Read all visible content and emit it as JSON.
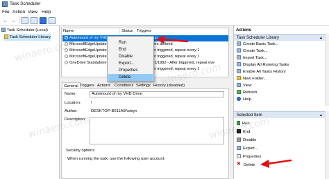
{
  "window": {
    "title": "Task Scheduler"
  },
  "menu": [
    "File",
    "Action",
    "View",
    "Help"
  ],
  "tree": {
    "items": [
      {
        "label": "Task Scheduler (Local)",
        "selected": false
      },
      {
        "label": "Task Scheduler Library",
        "selected": true
      }
    ]
  },
  "task_list": {
    "columns": [
      "Name",
      "Status",
      "Triggers"
    ],
    "rows": [
      {
        "name": "Automount of my VHD ...",
        "trigger": "startup",
        "selected": true
      },
      {
        "name": "MicrosoftEdgeUpdateT...",
        "trigger": "triggers defined",
        "selected": false
      },
      {
        "name": "MicrosoftEdgeUpdateT...",
        "trigger": "- After triggered, repeat every 1",
        "selected": false
      },
      {
        "name": "MicrosoftEdgeUpdateT...",
        "trigger": "- After triggered, repeat every 1",
        "selected": false
      },
      {
        "name": "OneDrive Standalone U...",
        "trigger": "on 5/1/1992 - After triggered, repeat eve",
        "selected": false
      },
      {
        "name": "",
        "trigger": "- After triggered, repeat every 1",
        "selected": false
      }
    ]
  },
  "context_menu": {
    "items": [
      "Run",
      "End",
      "Disable",
      "Export...",
      "Properties",
      "Delete"
    ],
    "highlighted": "Delete"
  },
  "tabs": [
    "General",
    "Triggers",
    "Actions",
    "Conditions",
    "Settings",
    "History (disabled)"
  ],
  "details": {
    "name_label": "Name:",
    "name_value": "Automount of my VHD Drive",
    "location_label": "Location:",
    "location_value": "\\",
    "author_label": "Author:",
    "author_value": "DESKTOP-B011A9I\\stsyn",
    "description_label": "Description:",
    "security_title": "Security options",
    "security_text": "When running the task, use the following user account:"
  },
  "actions_pane": {
    "title": "Actions",
    "library_section": "Task Scheduler Library",
    "library_items": [
      {
        "label": "Create Basic Task...",
        "icon": "create-basic-task-icon"
      },
      {
        "label": "Create Task...",
        "icon": "create-task-icon"
      },
      {
        "label": "Import Task...",
        "icon": "import-icon"
      },
      {
        "label": "Display All Running Tasks",
        "icon": "running-tasks-icon"
      },
      {
        "label": "Enable All Tasks History",
        "icon": "history-icon"
      },
      {
        "label": "New Folder...",
        "icon": "folder-icon"
      },
      {
        "label": "View",
        "icon": "view-icon"
      },
      {
        "label": "Refresh",
        "icon": "refresh-icon"
      },
      {
        "label": "Help",
        "icon": "help-icon"
      }
    ],
    "selected_section": "Selected Item",
    "selected_items": [
      {
        "label": "Run",
        "icon": "run-icon"
      },
      {
        "label": "End",
        "icon": "stop-icon"
      },
      {
        "label": "Disable",
        "icon": "disable-icon"
      },
      {
        "label": "Export...",
        "icon": "export-icon"
      },
      {
        "label": "Properties",
        "icon": "properties-icon"
      },
      {
        "label": "Delete",
        "icon": "delete-icon"
      }
    ]
  },
  "watermark": "winaero.com",
  "colors": {
    "selection": "#0a74d6",
    "highlight": "#91c9f7",
    "arrow": "#e01010",
    "section_header": "#dce6f4"
  }
}
